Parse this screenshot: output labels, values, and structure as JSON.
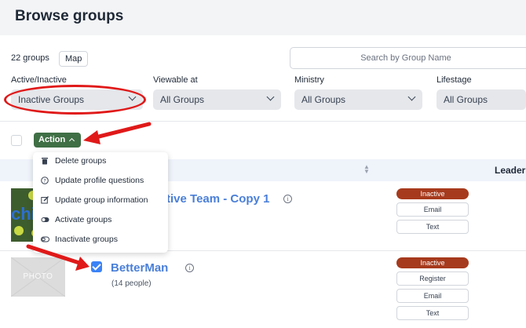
{
  "header": {
    "title": "Browse groups"
  },
  "toolbar": {
    "group_count": "22 groups",
    "map_label": "Map",
    "search_placeholder": "Search by Group Name"
  },
  "filters": [
    {
      "label": "Active/Inactive",
      "value": "Inactive Groups"
    },
    {
      "label": "Viewable at",
      "value": "All Groups"
    },
    {
      "label": "Ministry",
      "value": "All Groups"
    },
    {
      "label": "Lifestage",
      "value": "All Groups"
    }
  ],
  "action": {
    "label": "Action",
    "menu": [
      {
        "icon": "trash-icon",
        "label": "Delete groups"
      },
      {
        "icon": "question-icon",
        "label": "Update profile questions"
      },
      {
        "icon": "edit-icon",
        "label": "Update group information"
      },
      {
        "icon": "toggle-on-icon",
        "label": "Activate groups"
      },
      {
        "icon": "toggle-off-icon",
        "label": "Inactivate groups"
      }
    ]
  },
  "table": {
    "leader_header": "Leader"
  },
  "groups": [
    {
      "name": "tive Team - Copy 1",
      "thumbnail_text": "chi",
      "status": "Inactive",
      "buttons": [
        "Email",
        "Text"
      ]
    },
    {
      "name": "BetterMan",
      "people": "(14 people)",
      "thumbnail_text": "PHOTO",
      "status": "Inactive",
      "buttons": [
        "Register",
        "Email",
        "Text"
      ]
    }
  ],
  "colors": {
    "action_green": "#3f6f45",
    "link_blue": "#4a7fd8",
    "inactive_badge": "#a63a1d",
    "annotation_red": "#e01919",
    "checkbox_blue": "#3b82f6"
  }
}
